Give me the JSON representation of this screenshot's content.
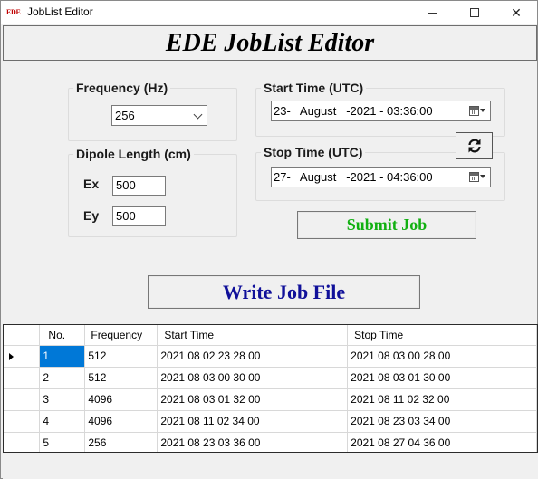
{
  "window": {
    "icon_text": "EDE",
    "title": "JobList Editor",
    "controls": {
      "minimize": "minimize",
      "maximize": "maximize",
      "close": "✕"
    }
  },
  "header": {
    "title": "EDE JobList Editor"
  },
  "frequency": {
    "group_title": "Frequency (Hz)",
    "selected": "256"
  },
  "dipole": {
    "group_title": "Dipole Length (cm)",
    "ex_label": "Ex",
    "ex_value": "500",
    "ey_label": "Ey",
    "ey_value": "500"
  },
  "start_time": {
    "group_title": "Start Time (UTC)",
    "value": "23-   August   -2021 - 03:36:00"
  },
  "stop_time": {
    "group_title": "Stop Time (UTC)",
    "value": "27-   August   -2021 - 04:36:00"
  },
  "buttons": {
    "refresh_icon": "refresh-icon",
    "submit": "Submit Job",
    "write": "Write Job File"
  },
  "colors": {
    "submit_text": "#11b011",
    "write_text": "#10109a",
    "selection": "#0078d7"
  },
  "grid": {
    "columns": [
      "No.",
      "Frequency",
      "Start Time",
      "Stop Time"
    ],
    "rows": [
      {
        "no": "1",
        "frequency": "512",
        "start": "2021 08 02 23 28 00",
        "stop": "2021 08 03 00 28 00"
      },
      {
        "no": "2",
        "frequency": "512",
        "start": "2021 08 03 00 30 00",
        "stop": "2021 08 03 01 30 00"
      },
      {
        "no": "3",
        "frequency": "4096",
        "start": "2021 08 03 01 32 00",
        "stop": "2021 08 11 02 32 00"
      },
      {
        "no": "4",
        "frequency": "4096",
        "start": "2021 08 11 02 34 00",
        "stop": "2021 08 23 03 34 00"
      },
      {
        "no": "5",
        "frequency": "256",
        "start": "2021 08 23 03 36 00",
        "stop": "2021 08 27 04 36 00"
      }
    ]
  }
}
